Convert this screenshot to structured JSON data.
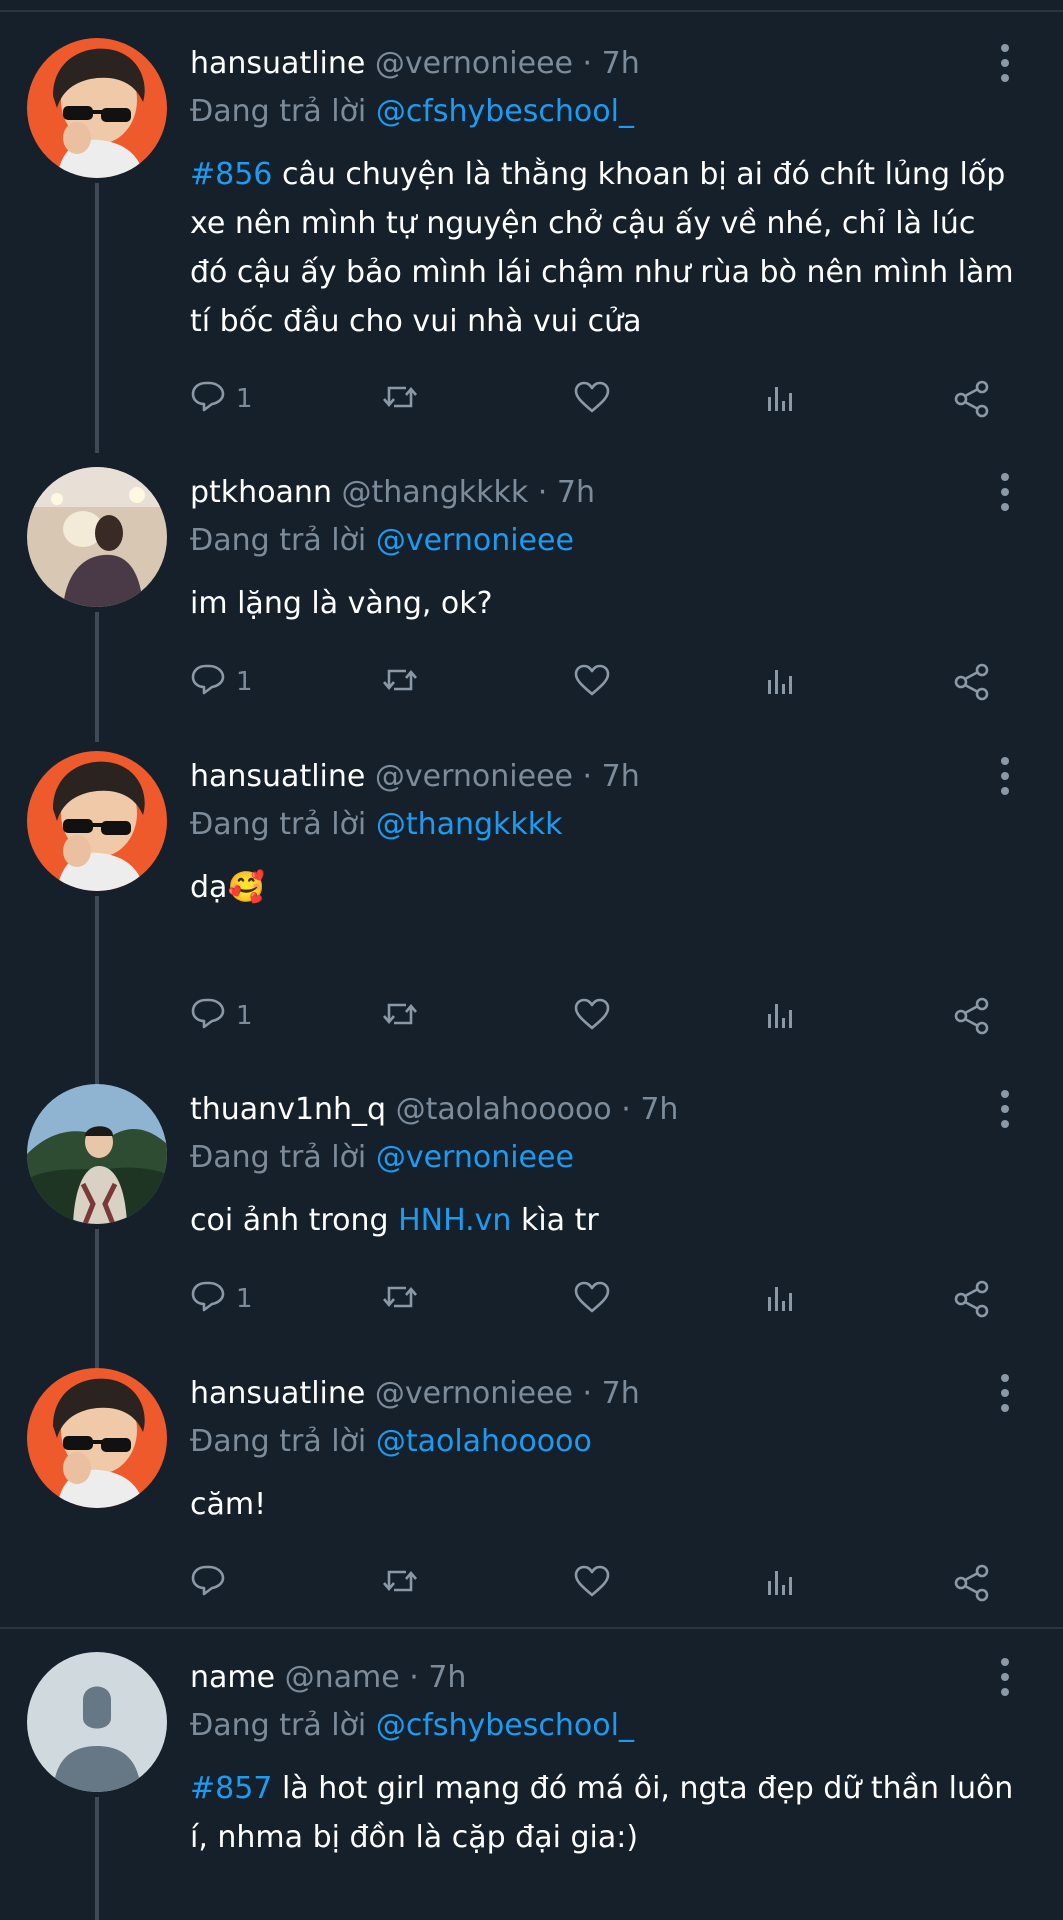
{
  "tweets": [
    {
      "display_name": "hansuatline",
      "handle": "@vernonieee",
      "dot": "·",
      "time": "7h",
      "reply_prefix": "Đang trả lời",
      "reply_to": "@cfshybeschool_",
      "hashtag": "#856",
      "text": " câu chuyện là thằng khoan bị ai đó chít lủng lốp xe nên mình tự nguyện chở cậu ấy về nhé, chỉ là lúc đó cậu ấy bảo mình lái chậm như rùa bò nên mình làm tí bốc đầu cho vui nhà vui cửa",
      "reply_count": "1",
      "avatar": "man-with-sunglasses"
    },
    {
      "display_name": "ptkhoann",
      "handle": "@thangkkkk",
      "dot": "·",
      "time": "7h",
      "reply_prefix": "Đang trả lời",
      "reply_to": "@vernonieee",
      "text": "im lặng là vàng, ok?",
      "reply_count": "1",
      "avatar": "man-holding-dog"
    },
    {
      "display_name": "hansuatline",
      "handle": "@vernonieee",
      "dot": "·",
      "time": "7h",
      "reply_prefix": "Đang trả lời",
      "reply_to": "@thangkkkk",
      "text": "dạ",
      "emoji": "🥰",
      "reply_count": "1",
      "avatar": "man-with-sunglasses"
    },
    {
      "display_name": "thuanv1nh_q",
      "handle": "@taolahooooo",
      "dot": "·",
      "time": "7h",
      "reply_prefix": "Đang trả lời",
      "reply_to": "@vernonieee",
      "text_before": "coi ảnh trong ",
      "link_text": "HNH.vn",
      "text_after": " kìa tr",
      "reply_count": "1",
      "avatar": "man-in-hills"
    },
    {
      "display_name": "hansuatline",
      "handle": "@vernonieee",
      "dot": "·",
      "time": "7h",
      "reply_prefix": "Đang trả lời",
      "reply_to": "@taolahooooo",
      "text": "căm!",
      "reply_count": "",
      "avatar": "man-with-sunglasses"
    },
    {
      "display_name": "name",
      "handle": "@name",
      "dot": "·",
      "time": "7h",
      "reply_prefix": "Đang trả lời",
      "reply_to": "@cfshybeschool_",
      "hashtag": "#857",
      "text": " là hot girl mạng đó má ôi, ngta đẹp dữ thần luôn í, nhma bị đồn là cặp đại gia:)",
      "avatar": "default-user-silhouette"
    }
  ],
  "icons": {
    "reply": "speech-bubble-icon",
    "retweet": "retweet-arrows-icon",
    "like": "heart-icon",
    "views": "bar-chart-icon",
    "share": "share-nodes-icon",
    "more": "vertical-dots-icon"
  },
  "colors": {
    "background": "#15202b",
    "link": "#1d9bf0",
    "muted": "#7d8c9a"
  }
}
